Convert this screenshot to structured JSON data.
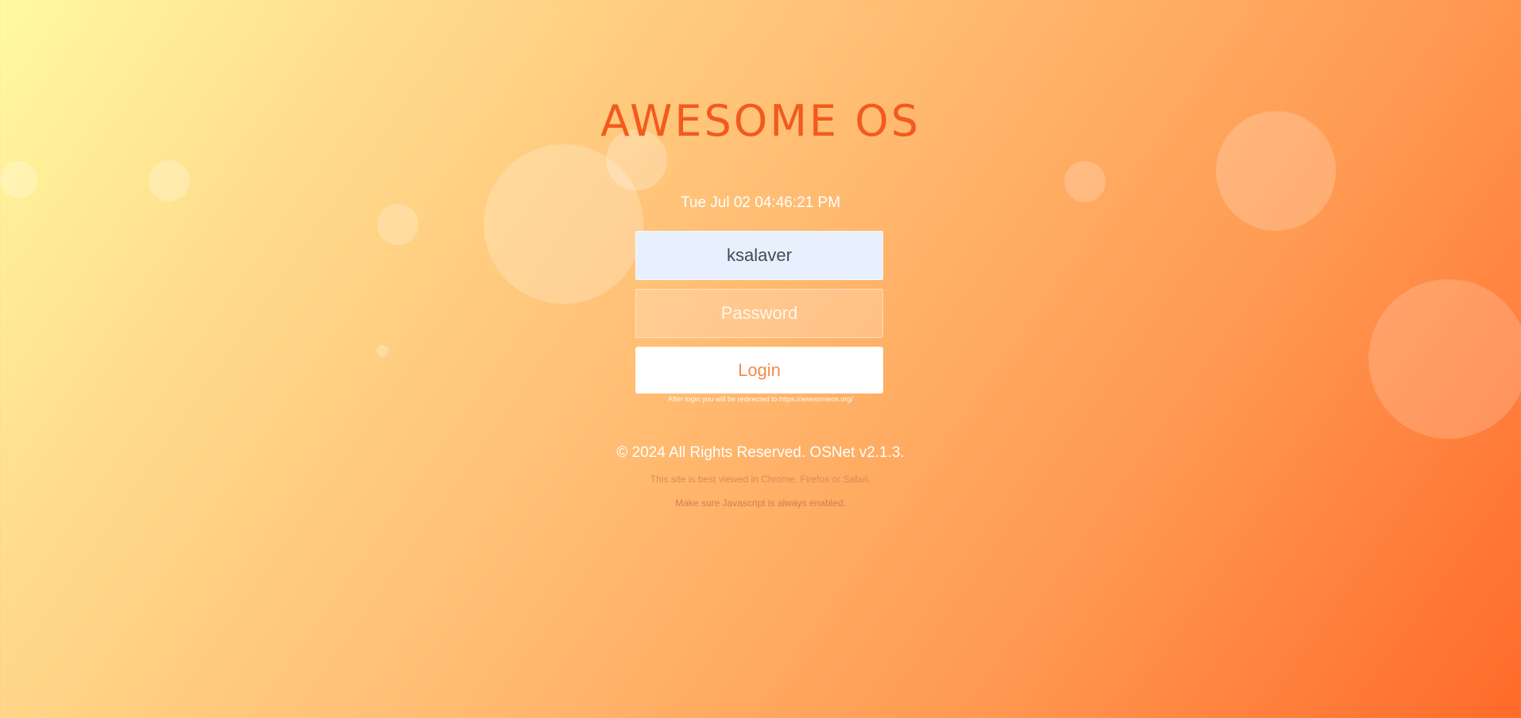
{
  "brand": {
    "title": "AWESOME OS",
    "accent_color": "#f25a1e"
  },
  "clock": {
    "datetime": "Tue Jul 02 04:46:21 PM"
  },
  "login_form": {
    "username_value": "ksalaver",
    "password_placeholder": "Password",
    "login_label": "Login",
    "redirect_note": "After login you will be redirected to https://awesomeos.org/"
  },
  "footer": {
    "copyright": "© 2024 All Rights Reserved. OSNet v2.1.3.",
    "browser_note": "This site is best viewed in Chrome, Firefox or Safari.",
    "javascript_note": "Make sure Javascript is always enabled."
  },
  "background": {
    "gradient_start": "#fffaa0",
    "gradient_end": "#ff6a2a"
  }
}
